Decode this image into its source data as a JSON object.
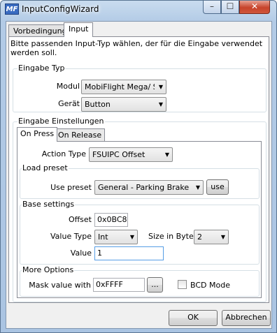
{
  "window": {
    "title": "InputConfigWizard",
    "icon_text": "MF",
    "controls": [
      "minimize-icon",
      "maximize-icon",
      "close-icon"
    ],
    "min_glyph": "–",
    "max_glyph": "☐",
    "close_glyph": "✕"
  },
  "tabs": [
    {
      "label": "Vorbedingung",
      "active": false
    },
    {
      "label": "Input",
      "active": true
    }
  ],
  "intro_text": "Bitte passenden Input-Typ wählen, der für die Eingabe verwendet werden soll.",
  "eingabe_typ": {
    "title": "Eingabe Typ",
    "modul_label": "Modul",
    "modul_value": "MobiFlight Mega/ SN",
    "geraet_label": "Gerät",
    "geraet_value": "Button"
  },
  "eingabe_einstellungen": {
    "title": "Eingabe Einstellungen",
    "inner_tabs": [
      {
        "label": "On Press",
        "active": true
      },
      {
        "label": "On Release",
        "active": false
      }
    ],
    "action_type_label": "Action Type",
    "action_type_value": "FSUIPC Offset",
    "load_preset": {
      "title": "Load preset",
      "use_preset_label": "Use preset",
      "preset_value": "General - Parking Brake",
      "use_button": "use"
    },
    "base_settings": {
      "title": "Base settings",
      "offset_label": "Offset",
      "offset_value": "0x0BC8",
      "value_type_label": "Value Type",
      "value_type_value": "Int",
      "size_label": "Size in Bytes",
      "size_value": "2",
      "value_label": "Value",
      "value_value": "1"
    },
    "more_options": {
      "title": "More Options",
      "mask_label": "Mask value with",
      "mask_value": "0xFFFF",
      "browse_button": "...",
      "bcd_label": "BCD Mode",
      "bcd_checked": false
    }
  },
  "buttons": {
    "ok": "OK",
    "cancel": "Abbrechen"
  },
  "dropdown_arrow": "▼"
}
